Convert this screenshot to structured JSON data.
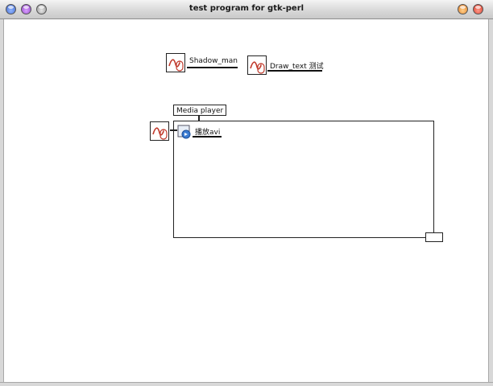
{
  "window": {
    "title": "test program for gtk-perl",
    "buttons_left": [
      "close-button",
      "shade-button",
      "menu-button"
    ],
    "buttons_right": [
      "minimize-button",
      "maximize-button"
    ]
  },
  "nodes": {
    "shadow_man": {
      "label": "Shadow_man",
      "icon": "mouse-icon"
    },
    "draw_text": {
      "label": "Draw_text 测试",
      "icon": "mouse-icon"
    },
    "media_player": {
      "label": "Media player",
      "child_label": "播放avi",
      "trigger_icon": "mouse-icon",
      "child_icon": "media-player-icon"
    }
  },
  "colors": {
    "canvas": "#ffffff",
    "icon_stroke": "#c0392b",
    "outline": "#222222"
  }
}
